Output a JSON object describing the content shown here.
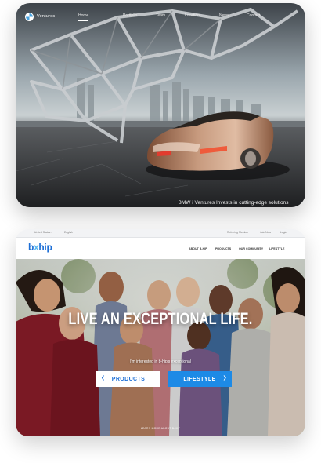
{
  "card_bmw": {
    "brand": "Ventures",
    "nav": [
      "Home",
      "Portfolio",
      "Team",
      "Location",
      "News",
      "Contact"
    ],
    "active_nav": "Home",
    "caption": "BMW i Ventures Invests in cutting-edge solutions"
  },
  "card_bxhip": {
    "topbar": {
      "left": [
        "United States ▾",
        "English"
      ],
      "right": [
        "Referring Member",
        "Join Now",
        "Login"
      ]
    },
    "logo": {
      "b": "b",
      "x": "x",
      "hip": "hip"
    },
    "nav": [
      "ABOUT B-HIP",
      "PRODUCTS",
      "OUR COMMUNITY",
      "LIFESTYLE"
    ],
    "headline": "LIVE AN EXCEPTIONAL LIFE.",
    "subline": "I'm interested in b-hip's exceptional",
    "buttons": {
      "products": "PRODUCTS",
      "lifestyle": "LIFESTYLE"
    },
    "learn_more": "LEARN MORE ABOUT B-HIP",
    "colors": {
      "brand_blue": "#1d6fd6",
      "button_blue": "#1d8ae6"
    }
  }
}
